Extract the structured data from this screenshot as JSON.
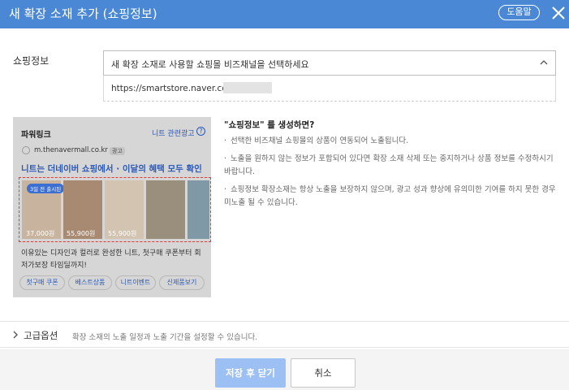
{
  "dialog": {
    "title": "새 확장 소재 추가 (쇼핑정보)",
    "help_label": "도움말"
  },
  "form": {
    "shop_label": "쇼핑정보",
    "select_placeholder": "새 확장 소재로 사용할 쇼핑몰 비즈채널을 선택하세요",
    "url_value": "https://smartstore.naver.com/"
  },
  "preview": {
    "title": "파워링크",
    "ad_link": "니트 관련광고",
    "info_glyph": "?",
    "site": "m.thenavermall.co.kr",
    "ad_tag": "광고",
    "headline": "니트는 더네이버 쇼핑에서 · 이달의 혜택 모두 확인",
    "badge": "3일 전 출시된",
    "prices": [
      "37,000원",
      "55,900원",
      "55,900원"
    ],
    "desc_line1": "이유있는 디자인과 컬러로 완성한 니트, 첫구매 쿠폰부터 회",
    "desc_line2": "저가보장 타임딜까지!",
    "chips": [
      "첫구매 쿠폰",
      "베스트상품",
      "니트이벤트",
      "신제품보기"
    ]
  },
  "info": {
    "title": "\"쇼핑정보\" 를 생성하면?",
    "bullet": "·",
    "p1": "선택한 비즈채널 쇼핑몰의 상품이 연동되어 노출됩니다.",
    "p2": "노출을 원하지 않는 정보가 포함되어 있다면 확장 소재 삭제 또는 중지하거나 상품 정보를 수정하시기 바랍니다.",
    "p3": "쇼핑정보 확장소재는 항상 노출을 보장하지 않으며, 광고 성과 향상에 유의미한 기여를 하지 못한 경우 미노출 될 수 있습니다."
  },
  "advanced": {
    "label": "고급옵션",
    "desc": "확장 소재의 노출 일정과 노출 기간을 설정할 수 있습니다."
  },
  "footer": {
    "save_label": "저장 후 닫기",
    "cancel_label": "취소"
  },
  "colors": {
    "titlebar": "#4a88d6",
    "link_blue": "#2a58b8",
    "save_button": "#9cc0f4",
    "highlight_dash": "#ee3333"
  },
  "icons": {
    "close": "close-icon",
    "select_chevron": "chevron-up-icon",
    "advanced_chevron": "chevron-right-icon"
  }
}
